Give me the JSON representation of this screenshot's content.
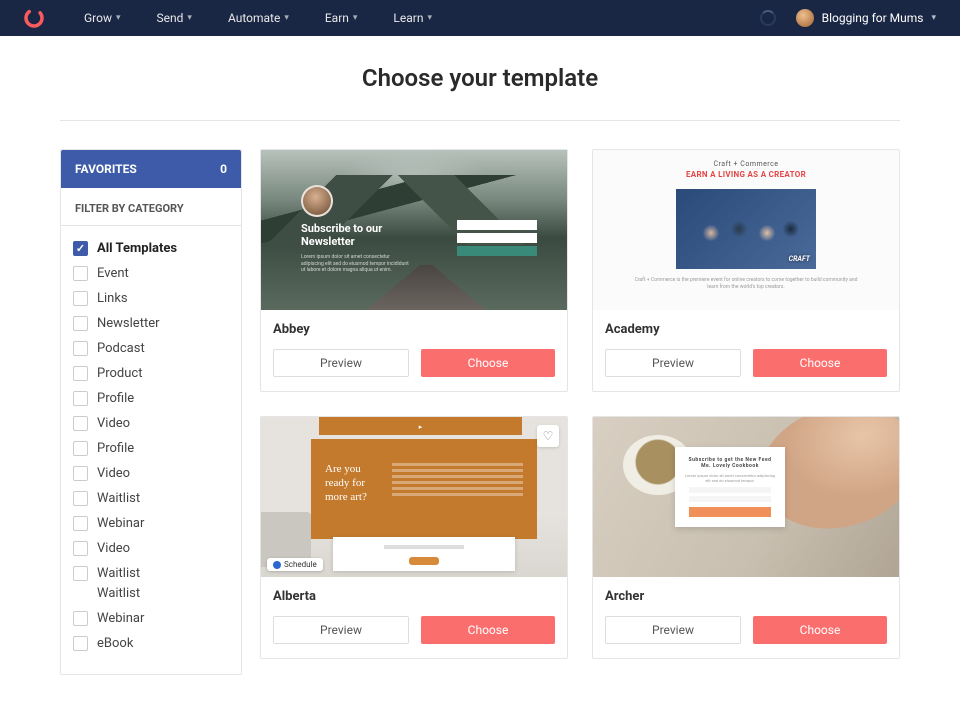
{
  "nav": {
    "items": [
      "Grow",
      "Send",
      "Automate",
      "Earn",
      "Learn"
    ],
    "account": "Blogging for Mums"
  },
  "page": {
    "title": "Choose your template"
  },
  "sidebar": {
    "favorites_label": "FAVORITES",
    "favorites_count": "0",
    "filter_label": "FILTER BY CATEGORY",
    "categories": [
      {
        "label": "All Templates",
        "checked": true
      },
      {
        "label": "Event",
        "checked": false
      },
      {
        "label": "Links",
        "checked": false
      },
      {
        "label": "Newsletter",
        "checked": false
      },
      {
        "label": "Podcast",
        "checked": false
      },
      {
        "label": "Product",
        "checked": false
      },
      {
        "label": "Profile",
        "checked": false
      },
      {
        "label": "Video",
        "checked": false
      },
      {
        "label": "Profile",
        "checked": false
      },
      {
        "label": "Video",
        "checked": false
      },
      {
        "label": "Waitlist",
        "checked": false
      },
      {
        "label": "Webinar",
        "checked": false
      },
      {
        "label": "Video",
        "checked": false
      },
      {
        "label": "Waitlist",
        "checked": false
      },
      {
        "label": "Waitlist",
        "checked": false
      },
      {
        "label": "Webinar",
        "checked": false
      },
      {
        "label": "eBook",
        "checked": false
      }
    ]
  },
  "templates": [
    {
      "name": "Abbey",
      "preview": "Preview",
      "choose": "Choose"
    },
    {
      "name": "Academy",
      "preview": "Preview",
      "choose": "Choose"
    },
    {
      "name": "Alberta",
      "preview": "Preview",
      "choose": "Choose"
    },
    {
      "name": "Archer",
      "preview": "Preview",
      "choose": "Choose"
    }
  ],
  "thumbs": {
    "abbey": {
      "heading": "Subscribe to our Newsletter"
    },
    "academy": {
      "line1": "Craft + Commerce",
      "line2": "EARN A LIVING AS A CREATOR",
      "logo": "CRAFT"
    },
    "alberta": {
      "question": "Are you ready for more art?",
      "schedule": "Schedule",
      "heart": "♡"
    },
    "archer": {
      "cta": "Subscribe to get the New Feed Me. Lovely Cookbook"
    }
  }
}
